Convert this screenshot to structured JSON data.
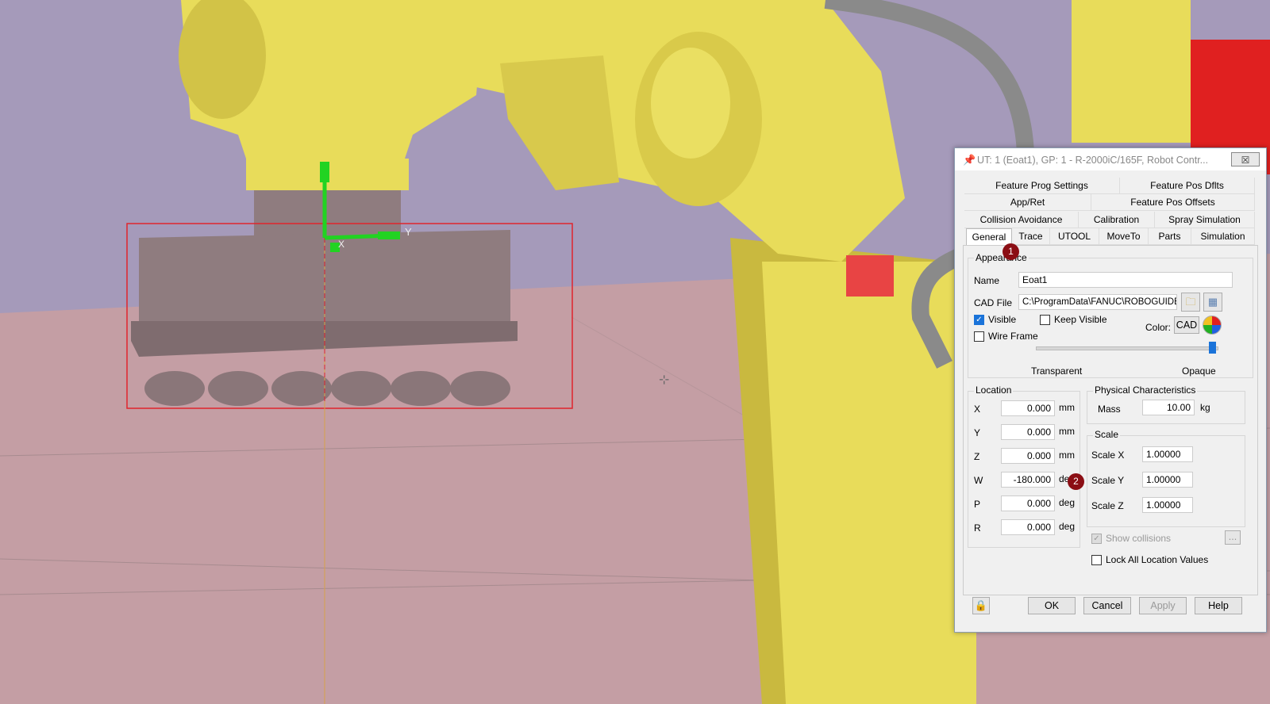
{
  "scene": {
    "colors": {
      "floor": "#c49ea4",
      "sky": "#a59aba",
      "robot": "#e8dc5a",
      "robot_shadow": "#c9b93f",
      "eoat": "#8f7c7f",
      "selection": "#e0242c",
      "axis": "#22d322",
      "cable": "#8a8a8a"
    },
    "axis_label_y": "Y",
    "axis_label_x": "X"
  },
  "dialog": {
    "title": "UT: 1  (Eoat1), GP: 1 - R-2000iC/165F, Robot Contr...",
    "close_label": "☒",
    "tabs_row1": [
      "Feature Prog Settings",
      "Feature Pos Dflts"
    ],
    "tabs_row2": [
      "App/Ret",
      "Feature Pos Offsets"
    ],
    "tabs_row3": [
      "Collision Avoidance",
      "Calibration",
      "Spray Simulation"
    ],
    "tabs_row4": [
      "General",
      "Trace",
      "UTOOL",
      "MoveTo",
      "Parts",
      "Simulation"
    ],
    "appearance": {
      "group_label": "Appearance",
      "name_label": "Name",
      "name_value": "Eoat1",
      "cad_label": "CAD File",
      "cad_value": "C:\\ProgramData\\FANUC\\ROBOGUIDE",
      "visible_label": "Visible",
      "keep_visible_label": "Keep Visible",
      "wireframe_label": "Wire Frame",
      "color_label": "Color:",
      "cad_button": "CAD",
      "transparent_label": "Transparent",
      "opaque_label": "Opaque",
      "opacity_level": 1.0
    },
    "location": {
      "group_label": "Location",
      "rows": [
        {
          "axis": "X",
          "value": "0.000",
          "unit": "mm"
        },
        {
          "axis": "Y",
          "value": "0.000",
          "unit": "mm"
        },
        {
          "axis": "Z",
          "value": "0.000",
          "unit": "mm"
        },
        {
          "axis": "W",
          "value": "-180.000",
          "unit": "deg"
        },
        {
          "axis": "P",
          "value": "0.000",
          "unit": "deg"
        },
        {
          "axis": "R",
          "value": "0.000",
          "unit": "deg"
        }
      ]
    },
    "physical": {
      "group_label": "Physical Characteristics",
      "mass_label": "Mass",
      "mass_value": "10.00",
      "mass_unit": "kg",
      "scale_label": "Scale",
      "scale": [
        {
          "label": "Scale X",
          "value": "1.00000"
        },
        {
          "label": "Scale Y",
          "value": "1.00000"
        },
        {
          "label": "Scale Z",
          "value": "1.00000"
        }
      ],
      "show_collisions_label": "Show collisions",
      "more_label": "...",
      "lock_label": "Lock All Location Values"
    },
    "buttons": {
      "ok": "OK",
      "cancel": "Cancel",
      "apply": "Apply",
      "help": "Help"
    },
    "badges": [
      "1",
      "2"
    ]
  }
}
